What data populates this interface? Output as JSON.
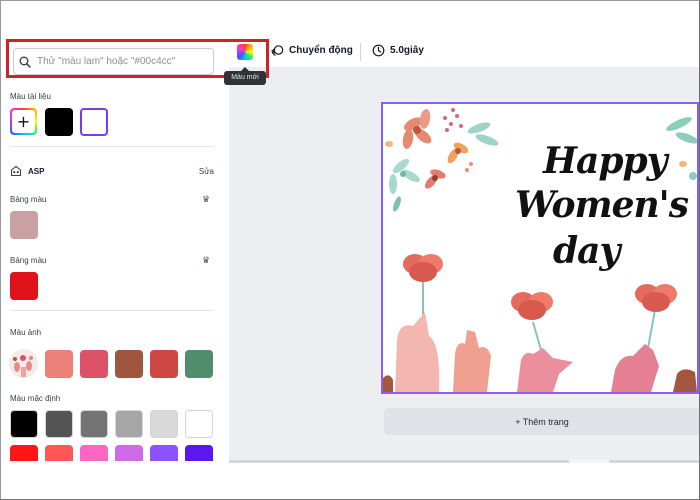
{
  "search": {
    "placeholder": "Thử \"màu lam\" hoặc \"#00c4cc\"",
    "tooltip": "Màu mới"
  },
  "toolbar": {
    "animate_label": "Chuyển động",
    "duration_label": "5.0giây"
  },
  "left_panel": {
    "document_colors_label": "Màu tài liệu",
    "document_colors": [
      "#000000",
      "#ffffff"
    ],
    "brand_kit": {
      "name": "ASP",
      "edit_label": "Sửa"
    },
    "palettes": [
      {
        "label": "Bảng màu",
        "color": "#c9a1a2"
      },
      {
        "label": "Bảng màu",
        "color": "#e0111a"
      }
    ],
    "photo_colors_label": "Màu ảnh",
    "photo_colors": [
      "#ec8078",
      "#de5268",
      "#a0553e",
      "#cf4742",
      "#4f8d6c"
    ],
    "default_colors_label": "Màu mặc định",
    "default_colors_row1": [
      "#000000",
      "#545454",
      "#737373",
      "#a6a6a6",
      "#d9d9d9",
      "#ffffff"
    ],
    "default_colors_row2": [
      "#ff1616",
      "#ff5757",
      "#ff66c4",
      "#cb6ce6",
      "#8c52ff",
      "#5e17eb"
    ]
  },
  "canvas": {
    "headline_line1": "Happy",
    "headline_line2": "Women's",
    "headline_line3": "day",
    "add_page_label": "+ Thêm trang"
  }
}
